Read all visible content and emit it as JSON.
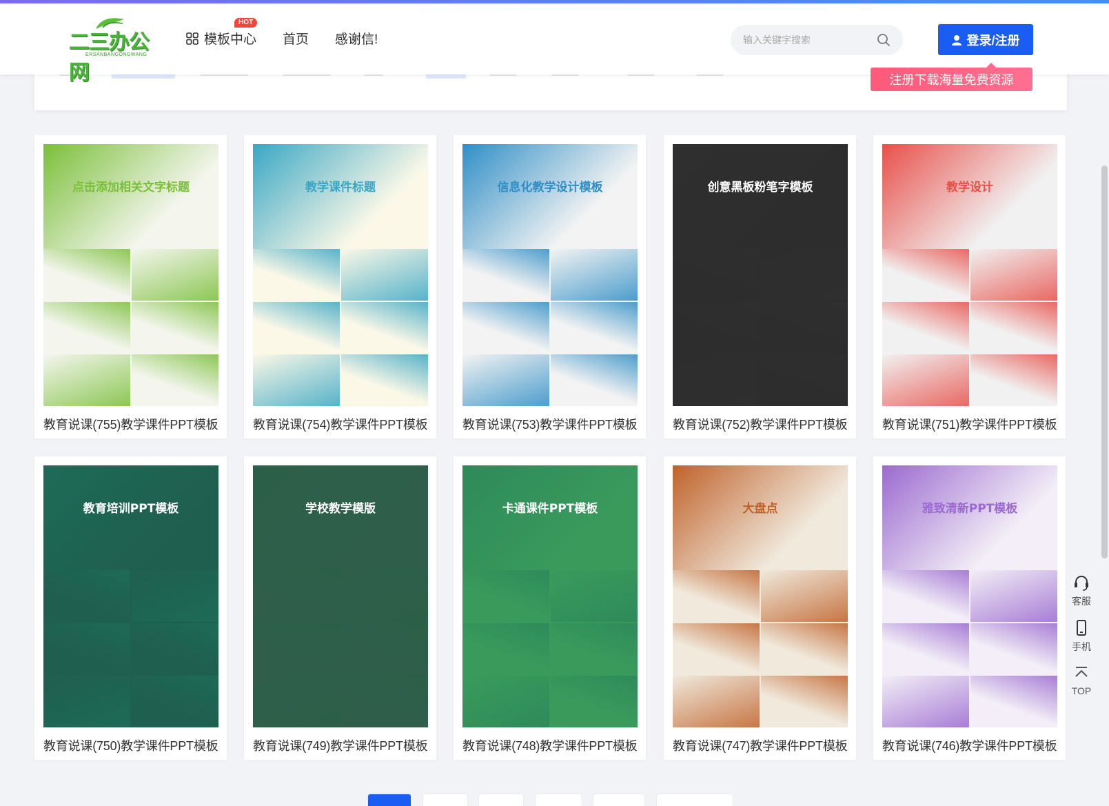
{
  "header": {
    "logo_text": "二三办公网",
    "logo_sub": "ERSANBANGONGWANG",
    "nav": [
      {
        "label": "模板中心",
        "badge": "HOT"
      },
      {
        "label": "首页"
      },
      {
        "label": "感谢信!"
      }
    ],
    "search_placeholder": "输入关键字搜索",
    "login_label": "登录/注册",
    "promo_label": "注册下载海量免费资源"
  },
  "cards": [
    {
      "title": "教育说课(755)教学课件PPT模板",
      "thumb_title": "点击添加相关文字标题",
      "theme": "#7bbf3a",
      "bg": "#f4f6ee"
    },
    {
      "title": "教育说课(754)教学课件PPT模板",
      "thumb_title": "教学课件标题",
      "theme": "#3aa7c4",
      "bg": "#fbf8e8"
    },
    {
      "title": "教育说课(753)教学课件PPT模板",
      "thumb_title": "信息化教学设计模板",
      "theme": "#2f8ec6",
      "bg": "#f3f3f3"
    },
    {
      "title": "教育说课(752)教学课件PPT模板",
      "thumb_title": "创意黑板粉笔字模板",
      "theme": "#2f2f2f",
      "bg": "#2d2d2d"
    },
    {
      "title": "教育说课(751)教学课件PPT模板",
      "thumb_title": "教学设计",
      "theme": "#e8504a",
      "bg": "#f1f1f1"
    },
    {
      "title": "教育说课(750)教学课件PPT模板",
      "thumb_title": "教育培训PPT模板",
      "theme": "#1e6b58",
      "bg": "#1f5f4f"
    },
    {
      "title": "教育说课(749)教学课件PPT模板",
      "thumb_title": "学校教学模版",
      "theme": "#2c5f48",
      "bg": "#2f5f4b"
    },
    {
      "title": "教育说课(748)教学课件PPT模板",
      "thumb_title": "卡通课件PPT模板",
      "theme": "#2e8a5a",
      "bg": "#3a9a5c"
    },
    {
      "title": "教育说课(747)教学课件PPT模板",
      "thumb_title": "大盘点",
      "theme": "#c0622a",
      "bg": "#f0e9dc"
    },
    {
      "title": "教育说课(746)教学课件PPT模板",
      "thumb_title": "雅致清新PPT模板",
      "theme": "#9b6ad0",
      "bg": "#f3eef7"
    }
  ],
  "side_tools": [
    {
      "label": "客服",
      "icon": "headset-icon"
    },
    {
      "label": "手机",
      "icon": "phone-icon"
    },
    {
      "label": "TOP",
      "icon": "arrow-up-icon"
    }
  ]
}
